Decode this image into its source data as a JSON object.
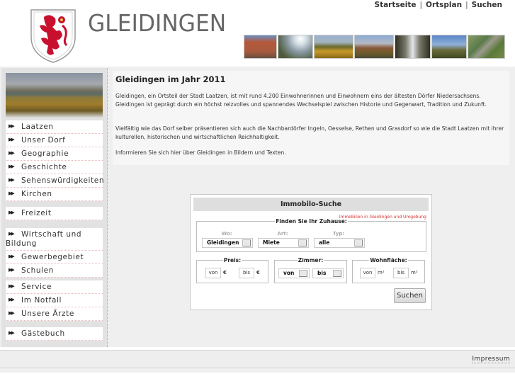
{
  "header": {
    "site_name": "GLEIDINGEN",
    "crest_icon": "coat-of-arms-red-lion",
    "topnav": [
      {
        "label": "Startseite"
      },
      {
        "label": "Ortsplan"
      },
      {
        "label": "Suchen"
      }
    ],
    "separator": "|",
    "photos": [
      {
        "name": "brick-house",
        "colors": [
          "#b5583a",
          "#6b7c8f"
        ]
      },
      {
        "name": "sun-field",
        "colors": [
          "#b8c4cc",
          "#5b6a44"
        ]
      },
      {
        "name": "autumn-meadow",
        "colors": [
          "#8fa8c2",
          "#9a7a22"
        ]
      },
      {
        "name": "church-trees",
        "colors": [
          "#8aa9cf",
          "#7a5a3a"
        ]
      },
      {
        "name": "river-trees",
        "colors": [
          "#d8dde0",
          "#3a3a2a"
        ]
      },
      {
        "name": "tower-sky",
        "colors": [
          "#5b86c8",
          "#4b5a2a"
        ]
      },
      {
        "name": "aerial-view",
        "colors": [
          "#7a8a5a",
          "#4a6a3a"
        ]
      }
    ]
  },
  "sidebar": {
    "groups": [
      {
        "items": [
          {
            "label": "Laatzen"
          },
          {
            "label": "Unser Dorf"
          },
          {
            "label": "Geographie"
          },
          {
            "label": "Geschichte"
          },
          {
            "label": "Sehenswürdigkeiten"
          },
          {
            "label": "Kirchen"
          }
        ]
      },
      {
        "items": [
          {
            "label": "Freizeit"
          }
        ]
      },
      {
        "items": [
          {
            "label": "Wirtschaft und Bildung"
          },
          {
            "label": "Gewerbegebiet"
          },
          {
            "label": "Schulen"
          }
        ]
      },
      {
        "items": [
          {
            "label": "Service"
          },
          {
            "label": "Im Notfall"
          },
          {
            "label": "Unsere Ärzte"
          }
        ]
      },
      {
        "items": [
          {
            "label": "Gästebuch"
          }
        ]
      }
    ],
    "bullet_icon": "double-arrow-right"
  },
  "content": {
    "title": "Gleidingen im Jahr 2011",
    "paragraphs": [
      "Gleidingen, ein Ortsteil der Stadt Laatzen, ist mit rund 4.200 Einwohnerinnen und Einwohnern eins der ältesten Dörfer Niedersachsens. Gleidingen ist geprägt durch ein höchst reizvolles und spannendes Wechselspiel zwischen Historie und Gegenwart, Tradition und Zukunft.",
      "Vielfältig wie das Dorf selber präsentieren sich auch die Nachbardörfer Ingeln, Oesselse, Rethen und Grasdorf so wie die Stadt Laatzen mit ihrer kulturellen, historischen und wirtschaftlichen Reichhaltigkeit.",
      "Informieren Sie sich hier über Gleidingen in Bildern und Texten."
    ]
  },
  "immo": {
    "title": "Immobilo-Suche",
    "subtitle_link": "Immobilien in Gleidingen und Umgebung",
    "find_legend": "Finden Sie Ihr Zuhause:",
    "wo_label": "Wo:",
    "wo_value": "Gleidingen",
    "art_label": "Art:",
    "art_value": "Miete",
    "typ_label": "Typ:",
    "typ_value": "alle",
    "preis_legend": "Preis:",
    "preis_von_placeholder": "von",
    "preis_bis_placeholder": "bis",
    "currency": "€",
    "zimmer_legend": "Zimmer:",
    "zimmer_von": "von",
    "zimmer_bis": "bis",
    "flaeche_legend": "Wohnfläche:",
    "flaeche_von_placeholder": "von",
    "flaeche_bis_placeholder": "bis",
    "area_unit": "m²",
    "search_button": "Suchen",
    "accent_color": "#d0312d"
  },
  "footer": {
    "impressum": "Impressum"
  }
}
